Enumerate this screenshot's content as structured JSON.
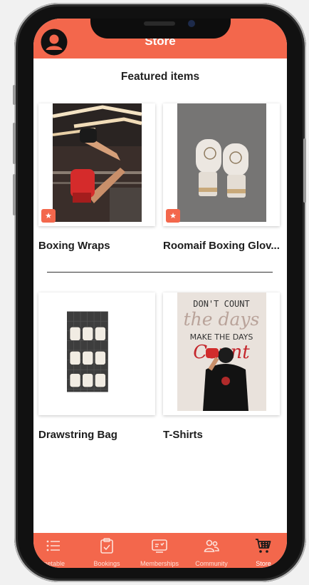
{
  "app": {
    "title": "Store",
    "accent": "#f3674c"
  },
  "section": {
    "title": "Featured items"
  },
  "products": [
    {
      "name": "Boxing Wraps",
      "featured": true
    },
    {
      "name": "Roomaif Boxing Glov...",
      "featured": true
    },
    {
      "name": "Drawstring Bag",
      "featured": false
    },
    {
      "name": "T-Shirts",
      "featured": false
    }
  ],
  "tshirt_poster": {
    "line1": "DON'T COUNT",
    "line2": "the days",
    "line3": "MAKE THE DAYS",
    "line4": "Count"
  },
  "nav": [
    {
      "label": "metable",
      "icon": "list-icon"
    },
    {
      "label": "Bookings",
      "icon": "clipboard-check-icon"
    },
    {
      "label": "Memberships",
      "icon": "membership-card-icon"
    },
    {
      "label": "Community",
      "icon": "people-icon"
    },
    {
      "label": "Store",
      "icon": "cart-icon",
      "active": true
    }
  ]
}
